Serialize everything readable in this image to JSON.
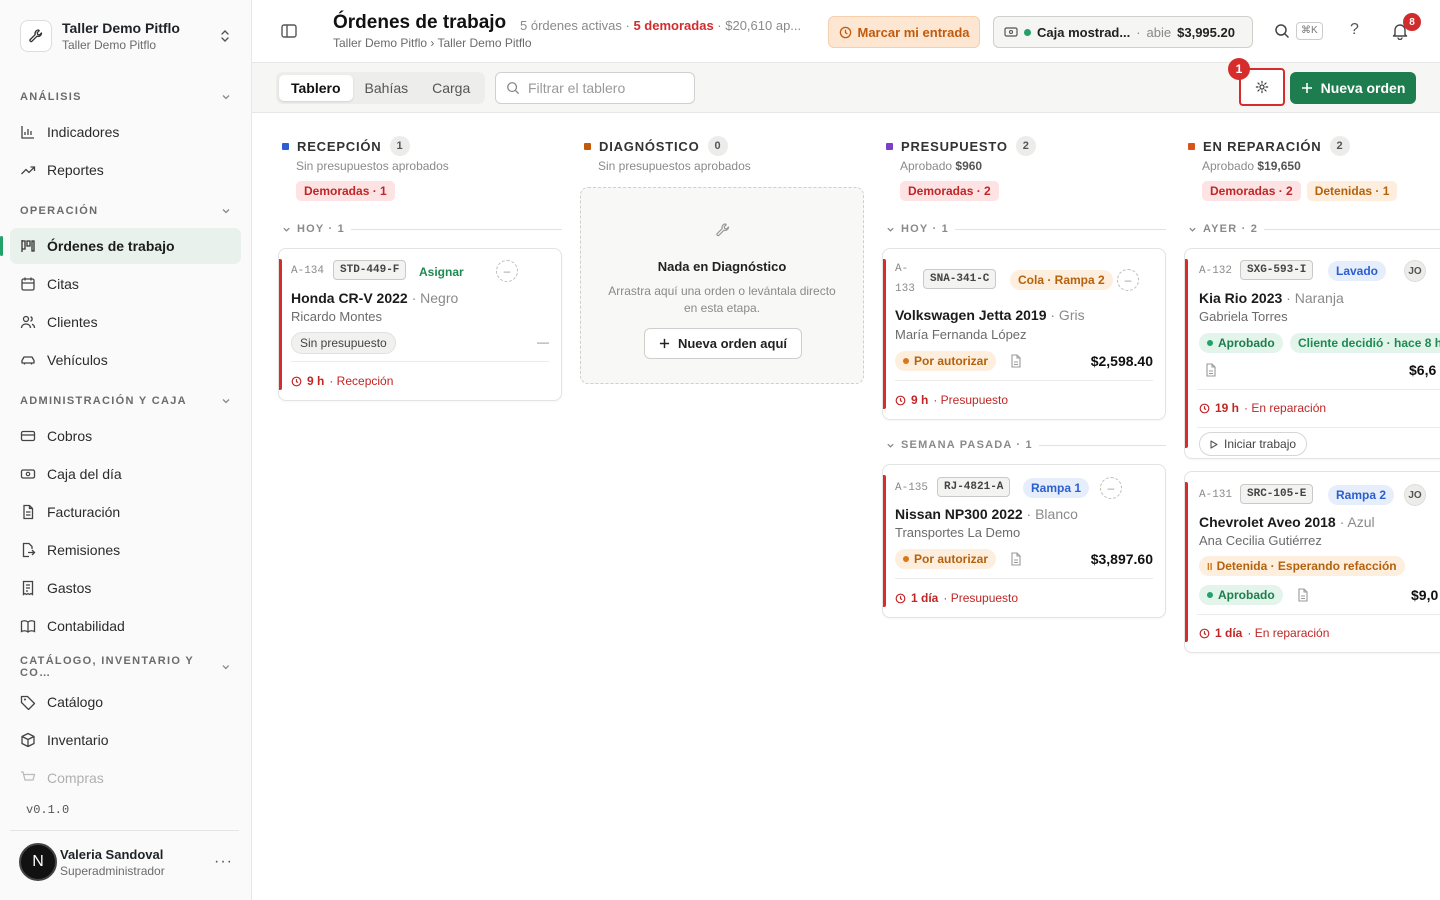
{
  "workspace": {
    "name": "Taller Demo Pitflo",
    "sub": "Taller Demo Pitflo"
  },
  "nav": {
    "sections": [
      {
        "label": "ANÁLISIS",
        "items": [
          "Indicadores",
          "Reportes"
        ]
      },
      {
        "label": "OPERACIÓN",
        "items": [
          "Órdenes de trabajo",
          "Citas",
          "Clientes",
          "Vehículos"
        ]
      },
      {
        "label": "ADMINISTRACIÓN Y CAJA",
        "items": [
          "Cobros",
          "Caja del día",
          "Facturación",
          "Remisiones",
          "Gastos",
          "Contabilidad"
        ]
      },
      {
        "label": "CATÁLOGO, INVENTARIO Y CO…",
        "items": [
          "Catálogo",
          "Inventario",
          "Compras"
        ]
      }
    ]
  },
  "version": "v0.1.0",
  "user": {
    "initial": "N",
    "name": "Valeria Sandoval",
    "role": "Superadministrador"
  },
  "header": {
    "title": "Órdenes de trabajo",
    "breadcrumb": "Taller Demo Pitflo › Taller Demo Pitflo",
    "stats_active": "5 órdenes activas ·",
    "stats_late": "5 demoradas",
    "stats_rest": "· $20,610 ap...",
    "entry_button": "Marcar mi entrada",
    "cash": {
      "name": "Caja mostrad...",
      "sep": "·",
      "status": "abie",
      "amount": "$3,995.20"
    },
    "search_kbd": "⌘K",
    "help": "?",
    "notifications": "8"
  },
  "toolbar": {
    "tabs": [
      "Tablero",
      "Bahías",
      "Carga"
    ],
    "filter_placeholder": "Filtrar el tablero",
    "marker": "1",
    "new_order": "Nueva orden"
  },
  "columns": [
    {
      "name": "RECEPCIÓN",
      "count": "1",
      "color": "#2b5fcf",
      "subtitle": "Sin presupuestos aprobados",
      "pills": [
        "Demoradas · 1"
      ],
      "group": "HOY · 1",
      "cards": [
        {
          "id": "A-134",
          "plate": "STD-449-F",
          "assign": "Asignar",
          "vehicle": "Honda CR-V 2022",
          "color": "· Negro",
          "customer": "Ricardo Montes",
          "status": "Sin presupuesto",
          "dash": "—",
          "time": "9 h",
          "stage": "· Recepción"
        }
      ]
    },
    {
      "name": "DIAGNÓSTICO",
      "count": "0",
      "color": "#c15a0c",
      "subtitle": "Sin presupuestos aprobados",
      "empty": {
        "title": "Nada en Diagnóstico",
        "text": "Arrastra aquí una orden o levántala directo en esta etapa.",
        "button": "Nueva orden aquí"
      }
    },
    {
      "name": "PRESUPUESTO",
      "count": "2",
      "color": "#7b3fc9",
      "subtitle_label": "Aprobado",
      "subtitle_value": "$960",
      "pills": [
        "Demoradas · 2"
      ],
      "groups": [
        "HOY · 1",
        "SEMANA PASADA · 1"
      ],
      "cards": [
        {
          "id_top": "A-",
          "id_bottom": "133",
          "plate": "SNA-341-C",
          "tag": "Cola · Rampa 2",
          "vehicle": "Volkswagen Jetta 2019",
          "color": "· Gris",
          "customer": "María Fernanda López",
          "status": "Por autorizar",
          "price": "$2,598.40",
          "time": "9 h",
          "stage": "· Presupuesto"
        },
        {
          "id": "A-135",
          "plate": "RJ-4821-A",
          "tag": "Rampa 1",
          "vehicle": "Nissan NP300 2022",
          "color": "· Blanco",
          "customer": "Transportes La Demo",
          "status": "Por autorizar",
          "price": "$3,897.60",
          "time": "1 día",
          "stage": "· Presupuesto"
        }
      ]
    },
    {
      "name": "EN REPARACIÓN",
      "count": "2",
      "color": "#d9541a",
      "subtitle_label": "Aprobado",
      "subtitle_value": "$19,650",
      "pills": [
        "Demoradas · 2",
        "Detenidas · 1"
      ],
      "group": "AYER · 2",
      "cards": [
        {
          "id": "A-132",
          "plate": "SXG-593-I",
          "tag": "Lavado",
          "initials": "JO",
          "vehicle": "Kia Rio 2023",
          "color": "· Naranja",
          "customer": "Gabriela Torres",
          "status": "Aprobado",
          "decision": "Cliente decidió · hace 8 h",
          "price": "$6,6",
          "time": "19 h",
          "stage": "· En reparación",
          "action": "Iniciar trabajo"
        },
        {
          "id": "A-131",
          "plate": "SRC-105-E",
          "tag": "Rampa 2",
          "initials": "JO",
          "vehicle": "Chevrolet Aveo 2018",
          "color": "· Azul",
          "customer": "Ana Cecilia Gutiérrez",
          "held": "Detenida · Esperando refacción",
          "status": "Aprobado",
          "price": "$9,0",
          "time": "1 día",
          "stage": "· En reparación"
        }
      ]
    }
  ]
}
